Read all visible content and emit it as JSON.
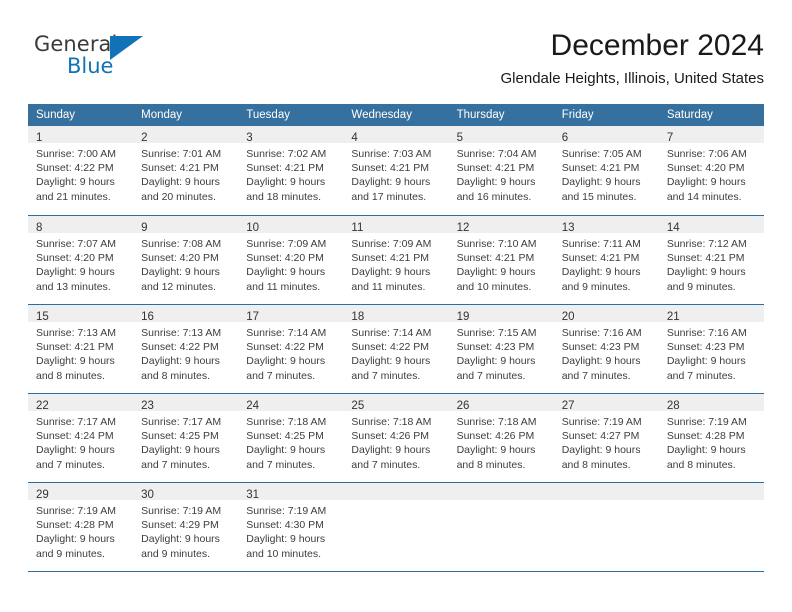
{
  "brand": {
    "name_top": "General",
    "name_bottom": "Blue",
    "accent_color": "#1272b8"
  },
  "header": {
    "month_title": "December 2024",
    "location": "Glendale Heights, Illinois, United States"
  },
  "calendar": {
    "header_color": "#35709f",
    "weekdays": [
      "Sunday",
      "Monday",
      "Tuesday",
      "Wednesday",
      "Thursday",
      "Friday",
      "Saturday"
    ],
    "weeks": [
      [
        {
          "day": "1",
          "sunrise": "Sunrise: 7:00 AM",
          "sunset": "Sunset: 4:22 PM",
          "daylight_1": "Daylight: 9 hours",
          "daylight_2": "and 21 minutes."
        },
        {
          "day": "2",
          "sunrise": "Sunrise: 7:01 AM",
          "sunset": "Sunset: 4:21 PM",
          "daylight_1": "Daylight: 9 hours",
          "daylight_2": "and 20 minutes."
        },
        {
          "day": "3",
          "sunrise": "Sunrise: 7:02 AM",
          "sunset": "Sunset: 4:21 PM",
          "daylight_1": "Daylight: 9 hours",
          "daylight_2": "and 18 minutes."
        },
        {
          "day": "4",
          "sunrise": "Sunrise: 7:03 AM",
          "sunset": "Sunset: 4:21 PM",
          "daylight_1": "Daylight: 9 hours",
          "daylight_2": "and 17 minutes."
        },
        {
          "day": "5",
          "sunrise": "Sunrise: 7:04 AM",
          "sunset": "Sunset: 4:21 PM",
          "daylight_1": "Daylight: 9 hours",
          "daylight_2": "and 16 minutes."
        },
        {
          "day": "6",
          "sunrise": "Sunrise: 7:05 AM",
          "sunset": "Sunset: 4:21 PM",
          "daylight_1": "Daylight: 9 hours",
          "daylight_2": "and 15 minutes."
        },
        {
          "day": "7",
          "sunrise": "Sunrise: 7:06 AM",
          "sunset": "Sunset: 4:20 PM",
          "daylight_1": "Daylight: 9 hours",
          "daylight_2": "and 14 minutes."
        }
      ],
      [
        {
          "day": "8",
          "sunrise": "Sunrise: 7:07 AM",
          "sunset": "Sunset: 4:20 PM",
          "daylight_1": "Daylight: 9 hours",
          "daylight_2": "and 13 minutes."
        },
        {
          "day": "9",
          "sunrise": "Sunrise: 7:08 AM",
          "sunset": "Sunset: 4:20 PM",
          "daylight_1": "Daylight: 9 hours",
          "daylight_2": "and 12 minutes."
        },
        {
          "day": "10",
          "sunrise": "Sunrise: 7:09 AM",
          "sunset": "Sunset: 4:20 PM",
          "daylight_1": "Daylight: 9 hours",
          "daylight_2": "and 11 minutes."
        },
        {
          "day": "11",
          "sunrise": "Sunrise: 7:09 AM",
          "sunset": "Sunset: 4:21 PM",
          "daylight_1": "Daylight: 9 hours",
          "daylight_2": "and 11 minutes."
        },
        {
          "day": "12",
          "sunrise": "Sunrise: 7:10 AM",
          "sunset": "Sunset: 4:21 PM",
          "daylight_1": "Daylight: 9 hours",
          "daylight_2": "and 10 minutes."
        },
        {
          "day": "13",
          "sunrise": "Sunrise: 7:11 AM",
          "sunset": "Sunset: 4:21 PM",
          "daylight_1": "Daylight: 9 hours",
          "daylight_2": "and 9 minutes."
        },
        {
          "day": "14",
          "sunrise": "Sunrise: 7:12 AM",
          "sunset": "Sunset: 4:21 PM",
          "daylight_1": "Daylight: 9 hours",
          "daylight_2": "and 9 minutes."
        }
      ],
      [
        {
          "day": "15",
          "sunrise": "Sunrise: 7:13 AM",
          "sunset": "Sunset: 4:21 PM",
          "daylight_1": "Daylight: 9 hours",
          "daylight_2": "and 8 minutes."
        },
        {
          "day": "16",
          "sunrise": "Sunrise: 7:13 AM",
          "sunset": "Sunset: 4:22 PM",
          "daylight_1": "Daylight: 9 hours",
          "daylight_2": "and 8 minutes."
        },
        {
          "day": "17",
          "sunrise": "Sunrise: 7:14 AM",
          "sunset": "Sunset: 4:22 PM",
          "daylight_1": "Daylight: 9 hours",
          "daylight_2": "and 7 minutes."
        },
        {
          "day": "18",
          "sunrise": "Sunrise: 7:14 AM",
          "sunset": "Sunset: 4:22 PM",
          "daylight_1": "Daylight: 9 hours",
          "daylight_2": "and 7 minutes."
        },
        {
          "day": "19",
          "sunrise": "Sunrise: 7:15 AM",
          "sunset": "Sunset: 4:23 PM",
          "daylight_1": "Daylight: 9 hours",
          "daylight_2": "and 7 minutes."
        },
        {
          "day": "20",
          "sunrise": "Sunrise: 7:16 AM",
          "sunset": "Sunset: 4:23 PM",
          "daylight_1": "Daylight: 9 hours",
          "daylight_2": "and 7 minutes."
        },
        {
          "day": "21",
          "sunrise": "Sunrise: 7:16 AM",
          "sunset": "Sunset: 4:23 PM",
          "daylight_1": "Daylight: 9 hours",
          "daylight_2": "and 7 minutes."
        }
      ],
      [
        {
          "day": "22",
          "sunrise": "Sunrise: 7:17 AM",
          "sunset": "Sunset: 4:24 PM",
          "daylight_1": "Daylight: 9 hours",
          "daylight_2": "and 7 minutes."
        },
        {
          "day": "23",
          "sunrise": "Sunrise: 7:17 AM",
          "sunset": "Sunset: 4:25 PM",
          "daylight_1": "Daylight: 9 hours",
          "daylight_2": "and 7 minutes."
        },
        {
          "day": "24",
          "sunrise": "Sunrise: 7:18 AM",
          "sunset": "Sunset: 4:25 PM",
          "daylight_1": "Daylight: 9 hours",
          "daylight_2": "and 7 minutes."
        },
        {
          "day": "25",
          "sunrise": "Sunrise: 7:18 AM",
          "sunset": "Sunset: 4:26 PM",
          "daylight_1": "Daylight: 9 hours",
          "daylight_2": "and 7 minutes."
        },
        {
          "day": "26",
          "sunrise": "Sunrise: 7:18 AM",
          "sunset": "Sunset: 4:26 PM",
          "daylight_1": "Daylight: 9 hours",
          "daylight_2": "and 8 minutes."
        },
        {
          "day": "27",
          "sunrise": "Sunrise: 7:19 AM",
          "sunset": "Sunset: 4:27 PM",
          "daylight_1": "Daylight: 9 hours",
          "daylight_2": "and 8 minutes."
        },
        {
          "day": "28",
          "sunrise": "Sunrise: 7:19 AM",
          "sunset": "Sunset: 4:28 PM",
          "daylight_1": "Daylight: 9 hours",
          "daylight_2": "and 8 minutes."
        }
      ],
      [
        {
          "day": "29",
          "sunrise": "Sunrise: 7:19 AM",
          "sunset": "Sunset: 4:28 PM",
          "daylight_1": "Daylight: 9 hours",
          "daylight_2": "and 9 minutes."
        },
        {
          "day": "30",
          "sunrise": "Sunrise: 7:19 AM",
          "sunset": "Sunset: 4:29 PM",
          "daylight_1": "Daylight: 9 hours",
          "daylight_2": "and 9 minutes."
        },
        {
          "day": "31",
          "sunrise": "Sunrise: 7:19 AM",
          "sunset": "Sunset: 4:30 PM",
          "daylight_1": "Daylight: 9 hours",
          "daylight_2": "and 10 minutes."
        },
        {
          "day": "",
          "sunrise": "",
          "sunset": "",
          "daylight_1": "",
          "daylight_2": ""
        },
        {
          "day": "",
          "sunrise": "",
          "sunset": "",
          "daylight_1": "",
          "daylight_2": ""
        },
        {
          "day": "",
          "sunrise": "",
          "sunset": "",
          "daylight_1": "",
          "daylight_2": ""
        },
        {
          "day": "",
          "sunrise": "",
          "sunset": "",
          "daylight_1": "",
          "daylight_2": ""
        }
      ]
    ]
  }
}
